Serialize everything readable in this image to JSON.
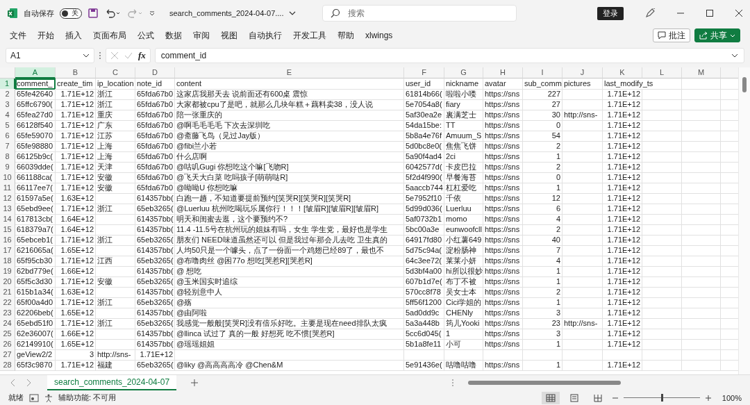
{
  "title_bar": {
    "autosave_label": "自动保存",
    "autosave": {
      "on": false,
      "label": "关"
    },
    "file_name": "search_comments_2024-04-07....",
    "search": {
      "placeholder": "搜索"
    },
    "login_button": "登录"
  },
  "menu": [
    "文件",
    "开始",
    "插入",
    "页面布局",
    "公式",
    "数据",
    "审阅",
    "视图",
    "自动执行",
    "开发工具",
    "帮助",
    "xlwings"
  ],
  "ribbon_buttons": [
    {
      "kind": "comment",
      "label": "批注"
    },
    {
      "kind": "share",
      "label": "共享"
    }
  ],
  "formula_bar": {
    "name_box": "A1",
    "function_label": "fx",
    "value": "comment_id"
  },
  "sheet": {
    "columns": [
      {
        "letter": "A",
        "selected": true
      },
      {
        "letter": "B",
        "selected": false
      },
      {
        "letter": "C",
        "selected": false
      },
      {
        "letter": "D",
        "selected": false
      },
      {
        "letter": "E",
        "selected": false
      },
      {
        "letter": "F",
        "selected": false
      },
      {
        "letter": "G",
        "selected": false
      },
      {
        "letter": "H",
        "selected": false
      },
      {
        "letter": "I",
        "selected": false
      },
      {
        "letter": "J",
        "selected": false
      },
      {
        "letter": "K",
        "selected": false
      },
      {
        "letter": "L",
        "selected": false
      },
      {
        "letter": "M",
        "selected": false
      }
    ],
    "rows": [
      {
        "number": "1",
        "selected": true,
        "cells": {
          "A": "comment_",
          "B": "create_tim",
          "C": "ip_location",
          "D": "note_id",
          "E": "content",
          "F": "user_id",
          "G": "nickname",
          "H": "avatar",
          "I": "sub_comm",
          "J": "pictures",
          "K": "last_modify_ts"
        }
      },
      {
        "number": "2",
        "selected": false,
        "cells": {
          "A": "65fe42640",
          "C": "浙江",
          "D": "65fda67b0",
          "E": "这家店我那天去 说前面还有600桌 震惊",
          "F": "61814b66(",
          "G": "啦啦小喽",
          "H": "https://sns"
        },
        "numbers": {
          "B": "1.71E+12",
          "I": "227",
          "K": "1.71E+12"
        }
      },
      {
        "number": "3",
        "selected": false,
        "cells": {
          "A": "65ffc6790(",
          "C": "浙江",
          "D": "65fda67b0",
          "E": "大家都被cpu了是吧，就那么几块年糕＋藕料卖38，没人说",
          "F": "5e7054a8(",
          "G": "fiary",
          "H": "https://sns"
        },
        "numbers": {
          "B": "1.71E+12",
          "I": "27",
          "K": "1.71E+12"
        }
      },
      {
        "number": "4",
        "selected": false,
        "cells": {
          "A": "65fea27d0",
          "C": "重庆",
          "D": "65fda67b0",
          "E": "陪一张重庆的",
          "F": "5af30ea2e",
          "G": "裏满芝士",
          "H": "https://sns",
          "J": "http://sns-"
        },
        "numbers": {
          "B": "1.71E+12",
          "I": "30",
          "K": "1.71E+12"
        }
      },
      {
        "number": "5",
        "selected": false,
        "cells": {
          "A": "66128f540",
          "C": "广东",
          "D": "65fda67b0",
          "E": "@啊毛毛毛毛 下次去深圳吃",
          "F": "54da15be:",
          "G": "TT",
          "H": "https://sns"
        },
        "numbers": {
          "B": "1.71E+12",
          "I": "0",
          "K": "1.71E+12"
        }
      },
      {
        "number": "6",
        "selected": false,
        "cells": {
          "A": "65fe59070",
          "C": "江苏",
          "D": "65fda67b0",
          "E": "@斋藤飞鸟（见过Jay版）",
          "F": "5b8a4e76f",
          "G": "Amuum_S",
          "H": "https://sns"
        },
        "numbers": {
          "B": "1.71E+12",
          "I": "54",
          "K": "1.71E+12"
        }
      },
      {
        "number": "7",
        "selected": false,
        "cells": {
          "A": "65fe98880",
          "C": "上海",
          "D": "65fda67b0",
          "E": "@fibi兰小若",
          "F": "5d0bc8e0(",
          "G": "焦焦飞饼",
          "H": "https://sns"
        },
        "numbers": {
          "B": "1.71E+12",
          "I": "2",
          "K": "1.71E+12"
        }
      },
      {
        "number": "8",
        "selected": false,
        "cells": {
          "A": "66125b9c(",
          "C": "上海",
          "D": "65fda67b0",
          "E": "什么店啊",
          "F": "5a90f4ad4",
          "G": "2ci",
          "H": "https://sns"
        },
        "numbers": {
          "B": "1.71E+12",
          "I": "1",
          "K": "1.71E+12"
        }
      },
      {
        "number": "9",
        "selected": false,
        "cells": {
          "A": "66039dde(",
          "C": "天津",
          "D": "65fda67b0",
          "E": "@咕叽Gugi 你想吃这个嘛[飞吻R]",
          "F": "6042577d(",
          "G": "卡皮巴拉",
          "H": "https://sns"
        },
        "numbers": {
          "B": "1.71E+12",
          "I": "2",
          "K": "1.71E+12"
        }
      },
      {
        "number": "10",
        "selected": false,
        "cells": {
          "A": "661188ca(",
          "C": "安徽",
          "D": "65fda67b0",
          "E": "@飞天大白菜 吃吗孩子[萌萌哒R]",
          "F": "5f2d4f990(",
          "G": "早餐海苔",
          "H": "https://sns"
        },
        "numbers": {
          "B": "1.71E+12",
          "I": "0",
          "K": "1.71E+12"
        }
      },
      {
        "number": "11",
        "selected": false,
        "cells": {
          "A": "66117ee7(",
          "C": "安徽",
          "D": "65fda67b0",
          "E": "@呦呦U 你想吃嘛",
          "F": "5aaccb744",
          "G": "杠杠爱吃",
          "H": "https://sns"
        },
        "numbers": {
          "B": "1.71E+12",
          "I": "1",
          "K": "1.71E+12"
        }
      },
      {
        "number": "12",
        "selected": false,
        "cells": {
          "A": "61597a5e(",
          "D": "614357bb(",
          "E": "白跑一趟，不知道要提前预约[笑哭R][笑哭R][笑哭R]",
          "F": "5e7952f10",
          "G": "千依",
          "H": "https://sns"
        },
        "numbers": {
          "B": "1.63E+12",
          "I": "12",
          "K": "1.71E+12"
        }
      },
      {
        "number": "13",
        "selected": false,
        "cells": {
          "A": "65ebd9ee(",
          "C": "浙江",
          "D": "65eb3265(",
          "E": "@Luerluu 杭州吃喝玩乐属你行！！！[皱眉R][皱眉R][皱眉R]",
          "F": "5d99d036(",
          "G": "Luerluu",
          "H": "https://sns"
        },
        "numbers": {
          "B": "1.71E+12",
          "I": "6",
          "K": "1.71E+12"
        }
      },
      {
        "number": "14",
        "selected": false,
        "cells": {
          "A": "617813cb(",
          "D": "614357bb(",
          "E": "明天和闺蜜去逛，这个要预约不?",
          "F": "5af0732b1",
          "G": "momo",
          "H": "https://sns"
        },
        "numbers": {
          "B": "1.64E+12",
          "I": "4",
          "K": "1.71E+12"
        }
      },
      {
        "number": "15",
        "selected": false,
        "cells": {
          "A": "618379a7(",
          "D": "614357bb(",
          "E": "11.4 -11.5号在杭州玩的姐妹有吗，女生 学生党，最好也是学生",
          "F": "5bc00a3e",
          "G": "eunwoofcll",
          "H": "https://sns"
        },
        "numbers": {
          "B": "1.64E+12",
          "I": "2",
          "K": "1.71E+12"
        }
      },
      {
        "number": "16",
        "selected": false,
        "cells": {
          "A": "65ebceb1(",
          "C": "浙江",
          "D": "65eb3265(",
          "E": "朋友们 NEED味道虽然还可以 但是我过年那会儿去吃 卫生真的",
          "F": "64917fd80",
          "G": "小红薯649",
          "H": "https://sns"
        },
        "numbers": {
          "B": "1.71E+12",
          "I": "40",
          "K": "1.71E+12"
        }
      },
      {
        "number": "17",
        "selected": false,
        "cells": {
          "A": "6216065a(",
          "D": "614357bb(",
          "E": "人均50只是一个噱头，点了一份面一个鸡翅已经89了，最也不",
          "F": "5d75c94a(",
          "G": "淀粉肠神",
          "H": "https://sns"
        },
        "numbers": {
          "B": "1.65E+12",
          "I": "7",
          "K": "1.71E+12"
        }
      },
      {
        "number": "18",
        "selected": false,
        "cells": {
          "A": "65f95cb30",
          "C": "江西",
          "D": "65eb3265(",
          "E": "@布噜肉丝 @困77o 想吃[哭惹R][哭惹R]",
          "F": "64c3ee72(",
          "G": "莱莱小妍",
          "H": "https://sns"
        },
        "numbers": {
          "B": "1.71E+12",
          "I": "4",
          "K": "1.71E+12"
        }
      },
      {
        "number": "19",
        "selected": false,
        "cells": {
          "A": "62bd779e(",
          "D": "614357bb(",
          "E": "@ 想吃",
          "F": "5d3bf4a00",
          "G": "hi所以很妙",
          "H": "https://sns"
        },
        "numbers": {
          "B": "1.66E+12",
          "I": "1",
          "K": "1.71E+12"
        }
      },
      {
        "number": "20",
        "selected": false,
        "cells": {
          "A": "65f5c3d30",
          "C": "安徽",
          "D": "65eb3265(",
          "E": "@玉米国实时追综",
          "F": "607b1d7e(",
          "G": "布丁不被",
          "H": "https://sns"
        },
        "numbers": {
          "B": "1.71E+12",
          "I": "1",
          "K": "1.71E+12"
        }
      },
      {
        "number": "21",
        "selected": false,
        "cells": {
          "A": "615b1a34(",
          "D": "614357bb(",
          "E": "@轻别意中人",
          "F": "570cc8f78",
          "G": "吴女士本",
          "H": "https://sns"
        },
        "numbers": {
          "B": "1.63E+12",
          "I": "2",
          "K": "1.71E+12"
        }
      },
      {
        "number": "22",
        "selected": false,
        "cells": {
          "A": "65f00a4d0",
          "C": "浙江",
          "D": "65eb3265(",
          "E": "@殇",
          "F": "5ff56f1200",
          "G": "Cici学姐的",
          "H": "https://sns"
        },
        "numbers": {
          "B": "1.71E+12",
          "I": "1",
          "K": "1.71E+12"
        }
      },
      {
        "number": "23",
        "selected": false,
        "cells": {
          "A": "62206beb(",
          "D": "614357bb(",
          "E": "@由阿啦",
          "F": "5ad0dd9c",
          "G": "CHENly",
          "H": "https://sns"
        },
        "numbers": {
          "B": "1.65E+12",
          "I": "3",
          "K": "1.71E+12"
        }
      },
      {
        "number": "24",
        "selected": false,
        "cells": {
          "A": "65ebd51f0",
          "C": "浙江",
          "D": "65eb3265(",
          "E": "我感觉一般般[笑哭R]没有倍乐好吃。主要是现在need排队太疯",
          "F": "5a3a448b",
          "G": "筠儿Yooki",
          "H": "https://sns",
          "J": "http://sns-"
        },
        "numbers": {
          "B": "1.71E+12",
          "I": "23",
          "K": "1.71E+12"
        }
      },
      {
        "number": "25",
        "selected": false,
        "cells": {
          "A": "62e36007(",
          "D": "614357bb(",
          "E": "@llinca 试过了 真的一般 好想死 吃不惯[哭惹R]",
          "F": "5cc6d045(",
          "G": "1",
          "H": "https://sns"
        },
        "numbers": {
          "B": "1.66E+12",
          "I": "3",
          "K": "1.71E+12"
        }
      },
      {
        "number": "26",
        "selected": false,
        "cells": {
          "A": "62149910(",
          "D": "614357bb(",
          "E": "@瑶瑶姐姐",
          "F": "5b1a8fe11",
          "G": "小可",
          "H": "https://sns"
        },
        "numbers": {
          "B": "1.65E+12",
          "I": "1",
          "K": "1.71E+12"
        }
      },
      {
        "number": "27",
        "selected": false,
        "cells": {
          "A": "geView2/2",
          "C": "http://sns-"
        },
        "numbers": {
          "B": "3",
          "D": "1.71E+12"
        }
      },
      {
        "number": "28",
        "selected": false,
        "cells": {
          "A": "65f3c9870",
          "C": "福建",
          "D": "65eb3265(",
          "E": "@liky @高高高高冷 @Chen&M",
          "F": "5e91436e(",
          "G": "咕噜咕噜",
          "H": "https://sns"
        },
        "numbers": {
          "B": "1.71E+12",
          "I": "1",
          "K": "1.71E+12"
        }
      }
    ]
  },
  "sheet_tabs": [
    {
      "label": "search_comments_2024-04-07",
      "selected": true
    }
  ],
  "status_bar": {
    "ready": "就绪",
    "accessibility": "辅助功能: 不可用",
    "views": [
      {
        "kind": "normal",
        "selected": true
      },
      {
        "kind": "page_layout",
        "selected": false
      },
      {
        "kind": "page_break",
        "selected": false
      }
    ],
    "zoom": {
      "level": 0.5,
      "reading": "100%"
    }
  }
}
